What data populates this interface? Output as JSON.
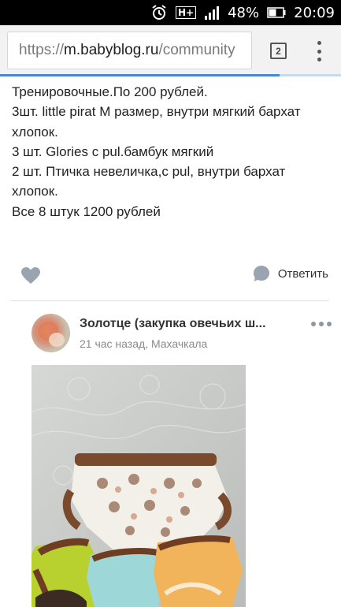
{
  "status_bar": {
    "network": "H+",
    "battery": "48%",
    "time": "20:09",
    "icons": [
      "alarm-icon",
      "network-type-icon",
      "signal-icon",
      "battery-icon"
    ]
  },
  "browser": {
    "url_scheme": "https://",
    "url_host": "m.babyblog.ru",
    "url_path": "/community",
    "tab_count": "2",
    "load_progress": 0.82,
    "accent_color": "#4a86d4"
  },
  "post": {
    "lines": [
      "Тренировочные.По 200 рублей.",
      "3шт. little pirat M размер, внутри мягкий бархат хлопок.",
      "3 шт. Glories с pul.бамбук мягкий",
      "2 шт. Птичка невеличка,с pul, внутри бархат хлопок.",
      "Все 8 штук 1200 рублей"
    ],
    "reply_label": "Ответить"
  },
  "comment": {
    "author": "Золотце (закупка овечьих ш...",
    "time": "21 час назад",
    "separator": ", ",
    "location": "Махачкала"
  }
}
